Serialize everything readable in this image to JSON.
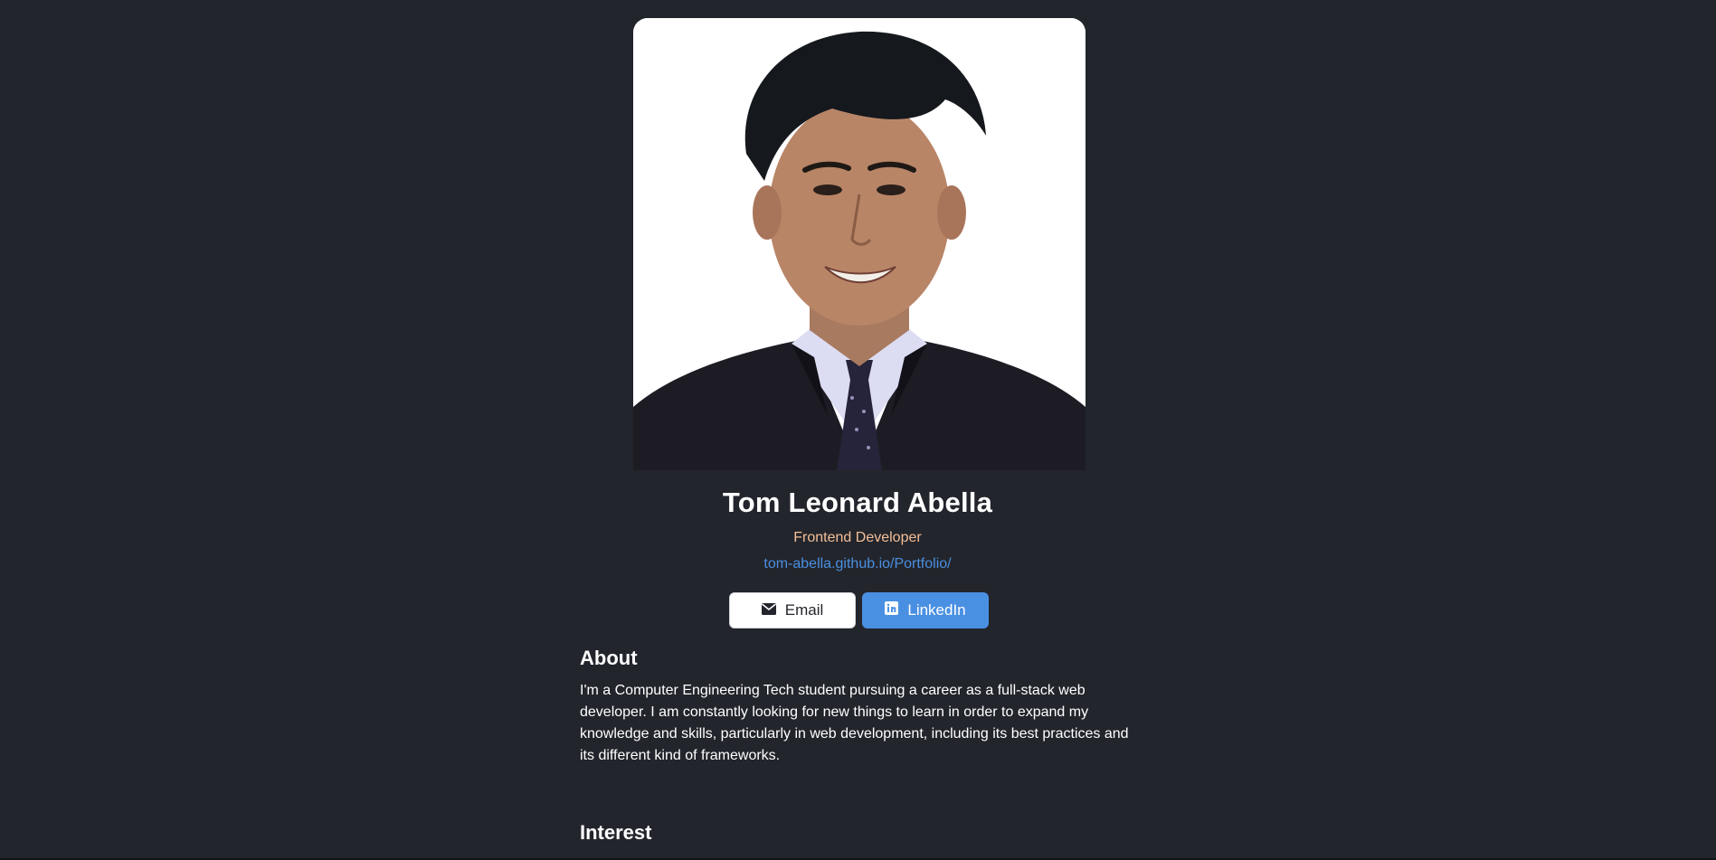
{
  "profile": {
    "name": "Tom Leonard Abella",
    "role": "Frontend Developer",
    "website": "tom-abella.github.io/Portfolio/",
    "photo_alt": "Tom Leonard Abella"
  },
  "actions": {
    "email_label": "Email",
    "linkedin_label": "LinkedIn",
    "email_icon": "envelope-icon",
    "linkedin_icon": "linkedin-icon"
  },
  "about": {
    "title": "About",
    "text": "I'm a Computer Engineering Tech student pursuing a career as a full-stack web developer. I am constantly looking for new things to learn in order to expand my knowledge and skills, particularly in web development, including its best practices and its different kind of frameworks."
  },
  "interest": {
    "title": "Interest"
  },
  "colors": {
    "background": "#23252c",
    "role_accent": "#f3bf99",
    "link_blue": "#4a8fe0",
    "linkedin_button": "#4a90e2"
  }
}
